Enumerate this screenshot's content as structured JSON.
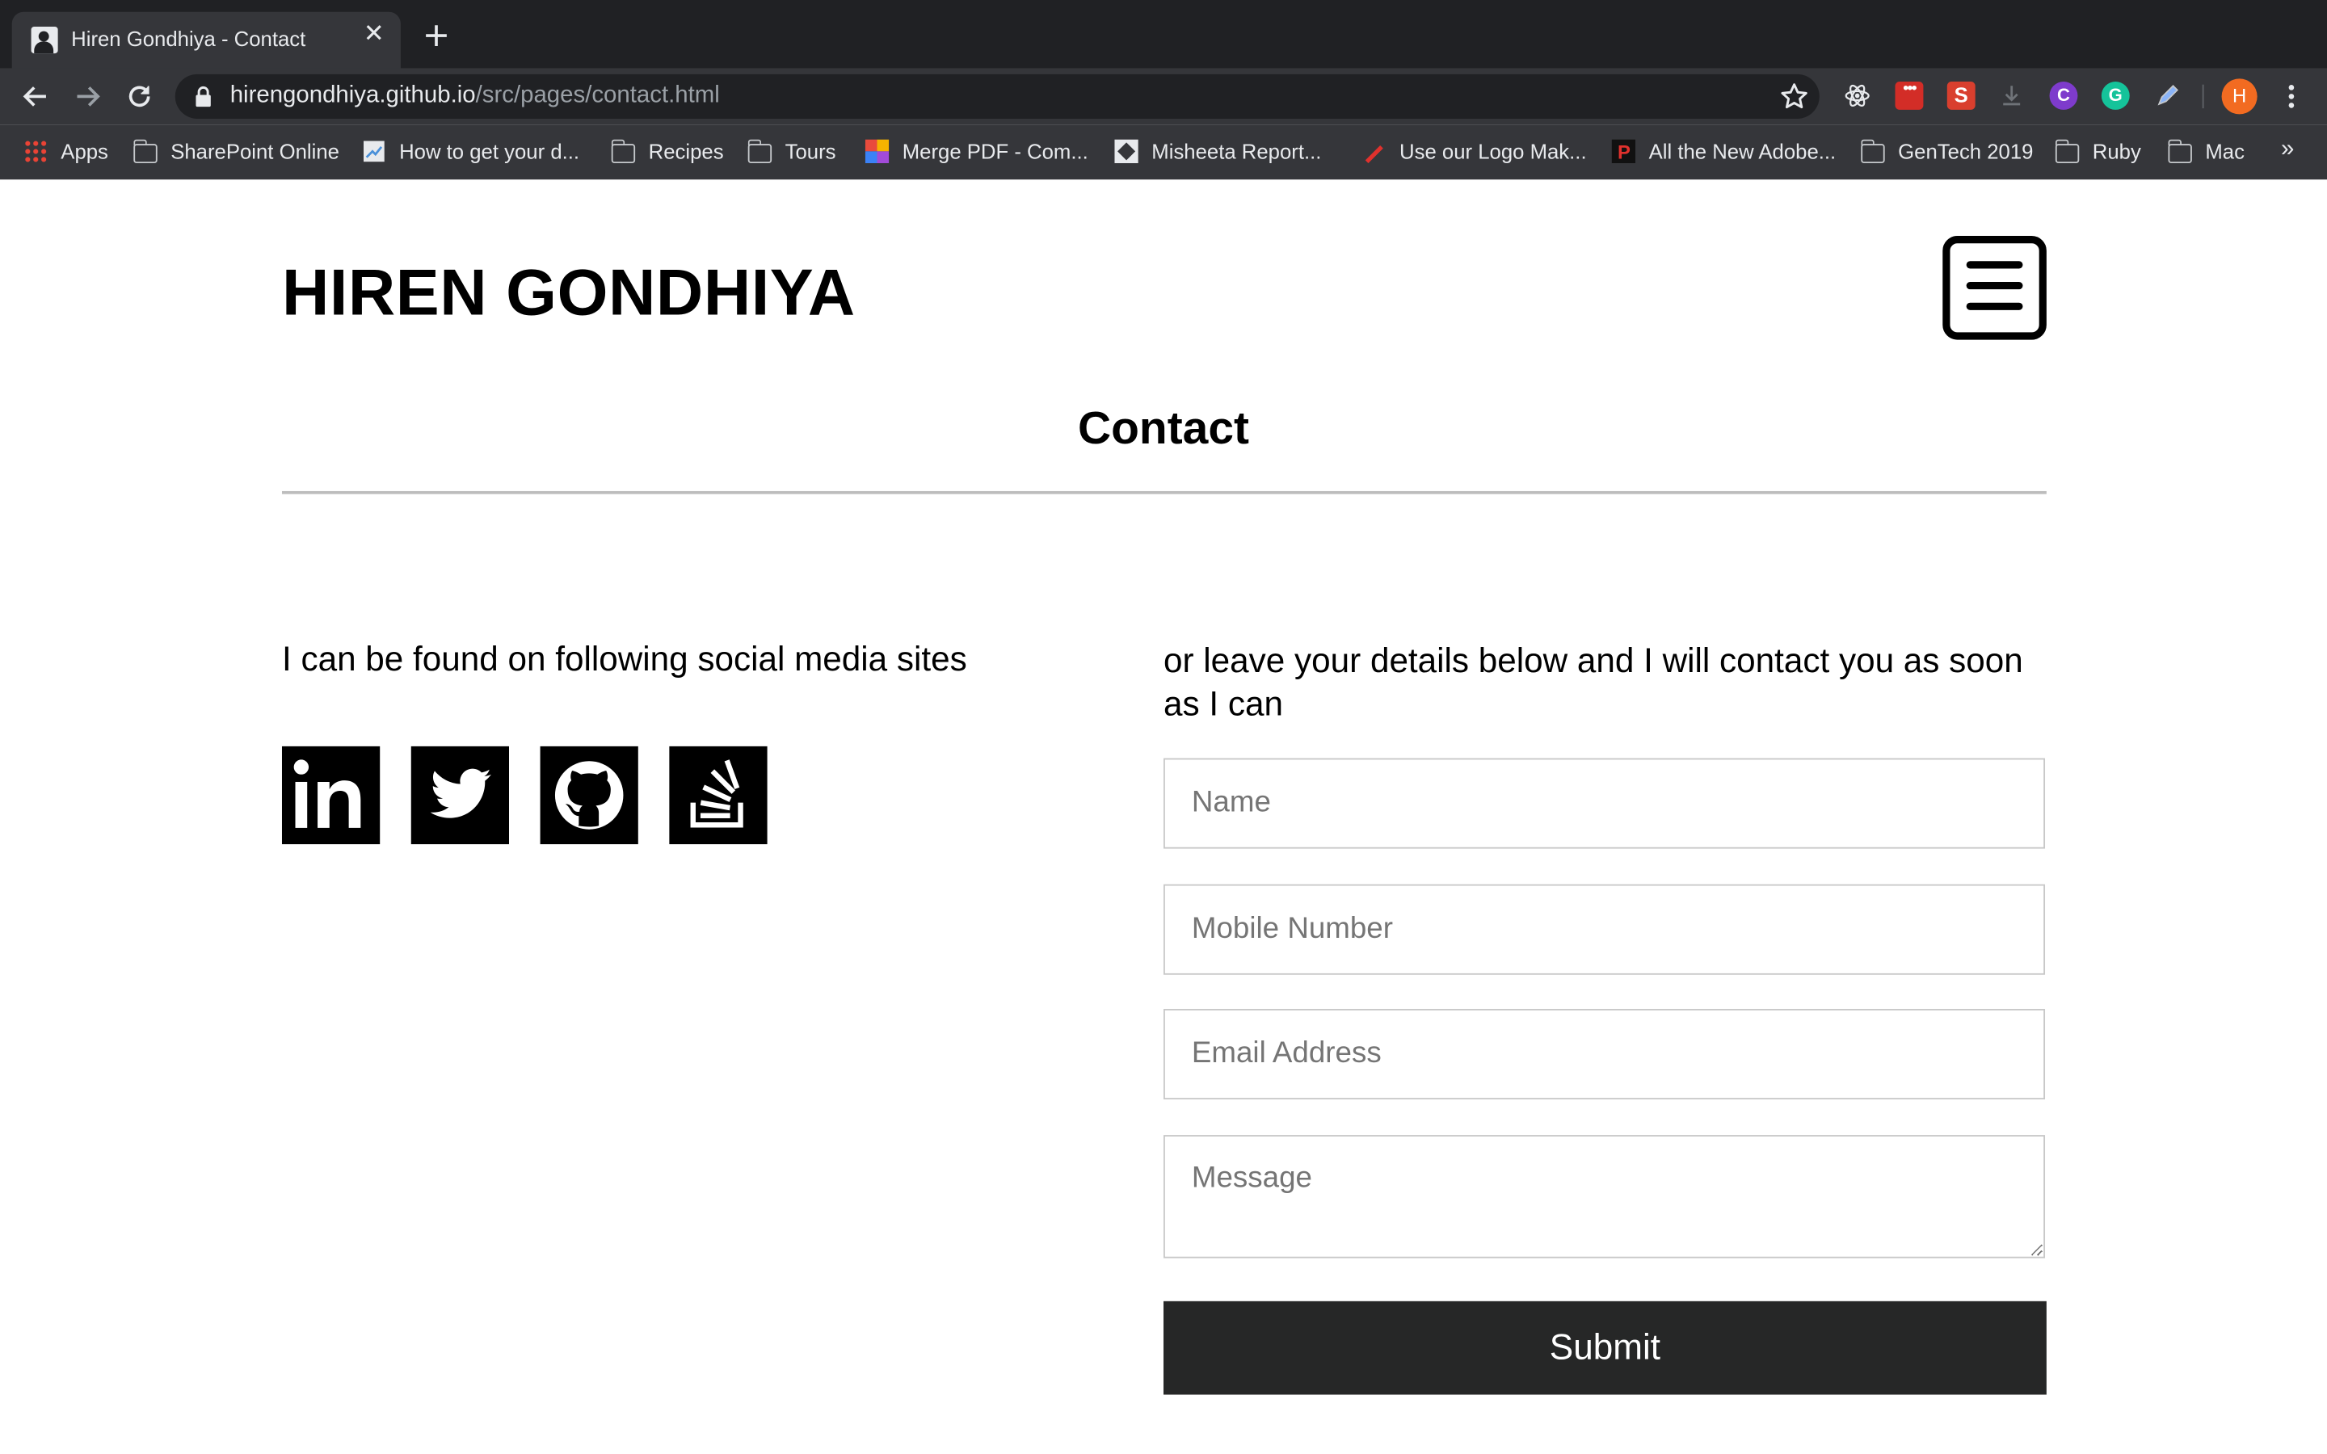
{
  "browser": {
    "tab": {
      "title": "Hiren Gondhiya - Contact"
    },
    "address": {
      "host": "hirengondhiya.github.io",
      "path": "/src/pages/contact.html"
    },
    "profile_initial": "H",
    "extensions": [
      {
        "name": "react-devtools-icon"
      },
      {
        "name": "lastpass-icon"
      },
      {
        "name": "s-extension-icon",
        "label": "S"
      },
      {
        "name": "download-icon"
      },
      {
        "name": "c-extension-icon",
        "label": "C"
      },
      {
        "name": "grammarly-icon",
        "label": "G"
      },
      {
        "name": "pen-icon"
      }
    ],
    "bookmarks": [
      {
        "label": "Apps",
        "icon": "apps-grid-icon"
      },
      {
        "label": "SharePoint Online",
        "icon": "folder-icon"
      },
      {
        "label": "How to get your d...",
        "icon": "page-icon"
      },
      {
        "label": "Recipes",
        "icon": "folder-icon"
      },
      {
        "label": "Tours",
        "icon": "folder-icon"
      },
      {
        "label": "Merge PDF - Com...",
        "icon": "colorful-grid-icon"
      },
      {
        "label": "Misheeta Report...",
        "icon": "site-icon"
      },
      {
        "label": "Use our Logo Mak...",
        "icon": "logo-maker-icon"
      },
      {
        "label": "All the New Adobe...",
        "icon": "p-site-icon"
      },
      {
        "label": "GenTech 2019",
        "icon": "folder-icon"
      },
      {
        "label": "Ruby",
        "icon": "folder-icon"
      },
      {
        "label": "Mac",
        "icon": "folder-icon"
      }
    ],
    "bookmarks_more": "»"
  },
  "site": {
    "title": "HIREN GONDHIYA",
    "menu_icon": "hamburger-menu-icon"
  },
  "page": {
    "heading": "Contact",
    "social_intro": "I can be found on following social media sites",
    "social_links": [
      {
        "name": "linkedin-icon"
      },
      {
        "name": "twitter-icon"
      },
      {
        "name": "github-icon"
      },
      {
        "name": "stackoverflow-icon"
      }
    ],
    "form_intro": "or leave your details below and I will contact you as soon as I can",
    "form": {
      "name_placeholder": "Name",
      "mobile_placeholder": "Mobile Number",
      "email_placeholder": "Email Address",
      "message_placeholder": "Message",
      "submit_label": "Submit"
    }
  },
  "colors": {
    "chrome_dark": "#202124",
    "chrome_toolbar": "#35363a",
    "submit_bg": "#262727",
    "avatar": "#f26b21"
  }
}
